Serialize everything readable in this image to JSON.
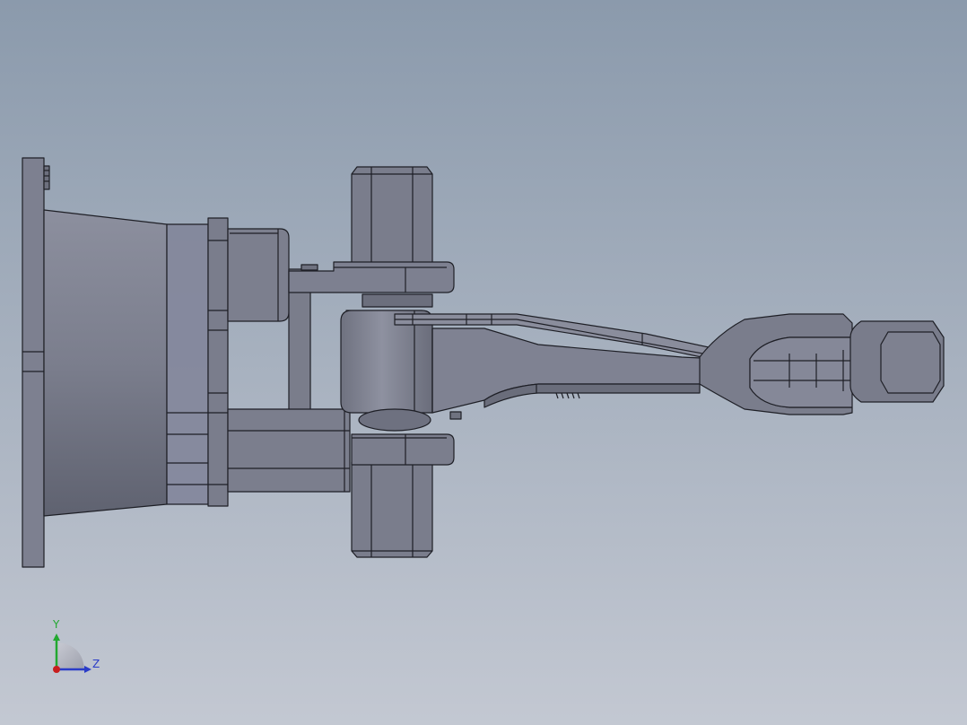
{
  "viewport": {
    "background_top": "#8b9aac",
    "background_bottom": "#c3c8d2",
    "model": {
      "part_fill": "#7c7f8e",
      "part_light": "#8a8d9c",
      "part_dark": "#5d606d",
      "edge_color": "#1e1f26"
    },
    "triad": {
      "y_label": "Y",
      "z_label": "Z",
      "y_color": "#22a830",
      "z_color": "#2a3cc8",
      "x_color": "#c81e1e"
    }
  }
}
